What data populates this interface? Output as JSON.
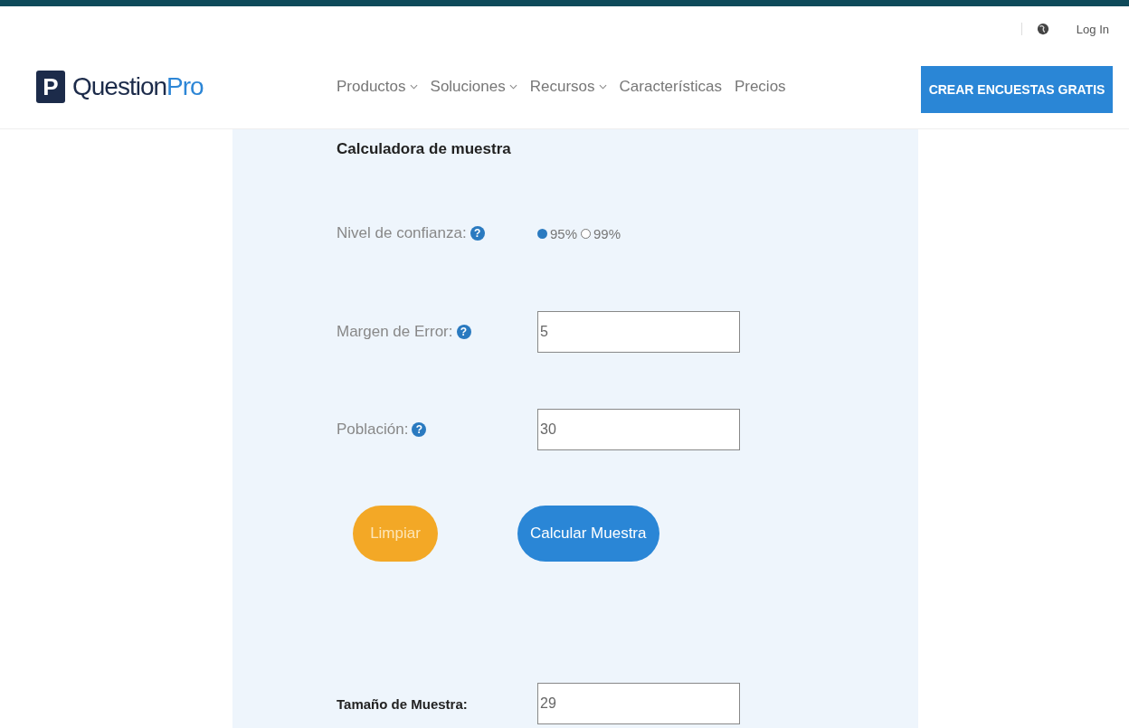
{
  "header": {
    "login": "Log In",
    "logo": {
      "mark": "P",
      "text_a": "Question",
      "text_b": "Pro"
    },
    "nav": [
      {
        "label": "Productos",
        "dropdown": true
      },
      {
        "label": "Soluciones",
        "dropdown": true
      },
      {
        "label": "Recursos",
        "dropdown": true
      },
      {
        "label": "Características",
        "dropdown": false
      },
      {
        "label": "Precios",
        "dropdown": false
      }
    ],
    "cta": "CREAR ENCUESTAS GRATIS"
  },
  "calculator": {
    "title": "Calculadora de muestra",
    "confidence": {
      "label": "Nivel de confianza:",
      "help": "?",
      "options": [
        {
          "label": "95%",
          "selected": true
        },
        {
          "label": "99%",
          "selected": false
        }
      ]
    },
    "fields": [
      {
        "label": "Margen de Error:",
        "help": "?",
        "value": "5"
      },
      {
        "label": "Población:",
        "help": "?",
        "value": "30"
      }
    ],
    "buttons": [
      {
        "label": "Limpiar",
        "kind": "reset"
      },
      {
        "label": "Calcular Muestra",
        "kind": "submit"
      }
    ],
    "result": {
      "label": "Tamaño de Muestra:",
      "value": "29"
    }
  }
}
